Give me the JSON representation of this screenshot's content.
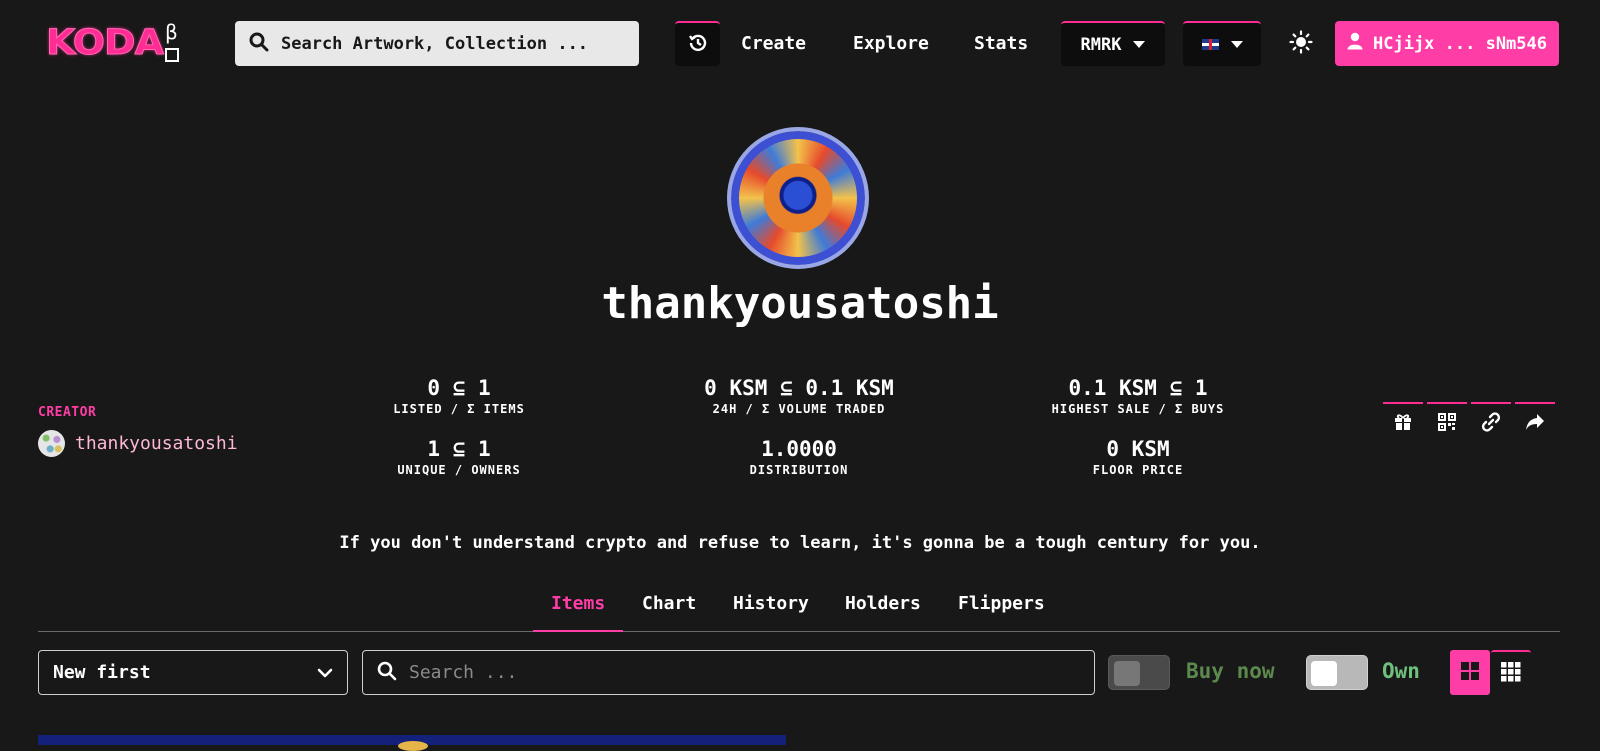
{
  "navbar": {
    "logo_text": "KODA",
    "logo_beta": "β",
    "search_placeholder": "Search Artwork, Collection ...",
    "links": {
      "create": "Create",
      "explore": "Explore",
      "stats": "Stats"
    },
    "chain_selector": "RMRK",
    "language_icon": "uk-flag-icon",
    "account_label": "HCjijx ... sNm546",
    "accent_color": "#ff3da6"
  },
  "collection": {
    "name": "thankyousatoshi",
    "creator_label": "CREATOR",
    "creator_name": "thankyousatoshi",
    "description": "If you don't understand crypto and refuse to learn, it's gonna be a tough century for you."
  },
  "stats": [
    {
      "value": "0 ⊆ 1",
      "label": "LISTED / Σ ITEMS"
    },
    {
      "value": "0 KSM ⊆ 0.1 KSM",
      "label": "24H / Σ VOLUME TRADED"
    },
    {
      "value": "0.1 KSM ⊆ 1",
      "label": "HIGHEST SALE / Σ BUYS"
    },
    {
      "value": "1 ⊆ 1",
      "label": "UNIQUE / OWNERS"
    },
    {
      "value": "1.0000",
      "label": "DISTRIBUTION"
    },
    {
      "value": "0 KSM",
      "label": "FLOOR PRICE"
    }
  ],
  "share_actions": [
    "gift-icon",
    "qr-code-icon",
    "link-icon",
    "share-icon"
  ],
  "tabs": [
    {
      "label": "Items",
      "active": true
    },
    {
      "label": "Chart",
      "active": false
    },
    {
      "label": "History",
      "active": false
    },
    {
      "label": "Holders",
      "active": false
    },
    {
      "label": "Flippers",
      "active": false
    }
  ],
  "filters": {
    "sort_value": "New first",
    "search_placeholder": "Search ...",
    "buy_now_label": "Buy now",
    "buy_now_on": false,
    "own_label": "Own",
    "own_on": false,
    "view_mode": "large-grid"
  }
}
